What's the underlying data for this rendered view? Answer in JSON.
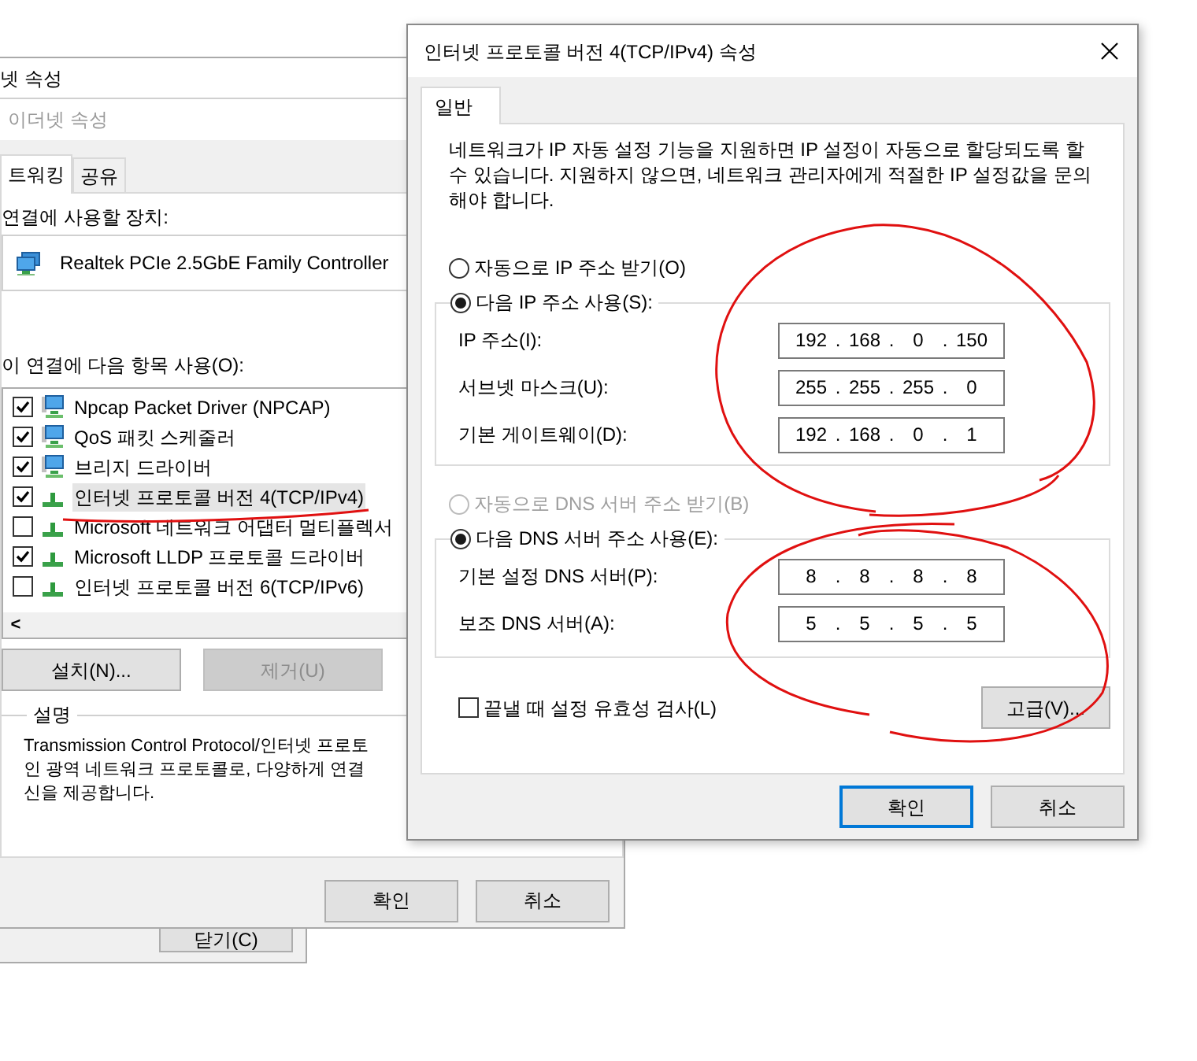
{
  "status_window": {
    "close_button": "닫기(C)"
  },
  "ethernet_window": {
    "title": "넷 속성",
    "subtitle": "이더넷 속성",
    "tabs": [
      {
        "label": "트워킹",
        "selected": true
      },
      {
        "label": "공유",
        "selected": false
      }
    ],
    "device_label": "연결에 사용할 장치:",
    "device": "Realtek PCIe 2.5GbE Family Controller",
    "items_label": "이 연결에 다음 항목 사용(O):",
    "items": [
      {
        "label": "Npcap Packet Driver (NPCAP)",
        "checked": true,
        "selected": false,
        "kind": "service"
      },
      {
        "label": "QoS 패킷 스케줄러",
        "checked": true,
        "selected": false,
        "kind": "service"
      },
      {
        "label": "브리지 드라이버",
        "checked": true,
        "selected": false,
        "kind": "service"
      },
      {
        "label": "인터넷 프로토콜 버전 4(TCP/IPv4)",
        "checked": true,
        "selected": true,
        "kind": "protocol"
      },
      {
        "label": "Microsoft 네트워크 어댑터 멀티플렉서",
        "checked": false,
        "selected": false,
        "kind": "protocol"
      },
      {
        "label": "Microsoft LLDP 프로토콜 드라이버",
        "checked": true,
        "selected": false,
        "kind": "protocol"
      },
      {
        "label": "인터넷 프로토콜 버전 6(TCP/IPv6)",
        "checked": false,
        "selected": false,
        "kind": "protocol"
      }
    ],
    "scroll_arrow": "<",
    "buttons": [
      {
        "label": "설치(N)...",
        "disabled": false
      },
      {
        "label": "제거(U)",
        "disabled": true
      }
    ],
    "description_title": "설명",
    "description_lines": [
      "Transmission Control Protocol/인터넷 프로토",
      "인 광역 네트워크 프로토콜로, 다양하게 연결",
      "신을 제공합니다."
    ],
    "footer_buttons": [
      "확인",
      "취소"
    ]
  },
  "ipv4_dialog": {
    "title": "인터넷 프로토콜 버전 4(TCP/IPv4) 속성",
    "tabs": [
      {
        "label": "일반",
        "selected": true
      }
    ],
    "intro": "네트워크가 IP 자동 설정 기능을 지원하면 IP 설정이 자동으로 할당되도록 할 수 있습니다. 지원하지 않으면, 네트워크 관리자에게 적절한 IP 설정값을 문의해야 합니다.",
    "ip_modes": [
      {
        "label": "자동으로 IP 주소 받기(O)",
        "selected": false,
        "disabled": false
      },
      {
        "label": "다음 IP 주소 사용(S):",
        "selected": true,
        "disabled": false
      }
    ],
    "ip_fields": [
      {
        "label": "IP 주소(I):",
        "segments": [
          "192",
          ".",
          "168",
          ".",
          "0",
          ".",
          "150"
        ]
      },
      {
        "label": "서브넷 마스크(U):",
        "segments": [
          "255",
          ".",
          "255",
          ".",
          "255",
          ".",
          "0"
        ]
      },
      {
        "label": "기본 게이트웨이(D):",
        "segments": [
          "192",
          ".",
          "168",
          ".",
          "0",
          ".",
          "1"
        ]
      }
    ],
    "dns_modes": [
      {
        "label": "자동으로 DNS 서버 주소 받기(B)",
        "selected": false,
        "disabled": true
      },
      {
        "label": "다음 DNS 서버 주소 사용(E):",
        "selected": true,
        "disabled": false
      }
    ],
    "dns_fields": [
      {
        "label": "기본 설정 DNS 서버(P):",
        "segments": [
          "8",
          ".",
          "8",
          ".",
          "8",
          ".",
          "8"
        ]
      },
      {
        "label": "보조 DNS 서버(A):",
        "segments": [
          "5",
          ".",
          "5",
          ".",
          "5",
          ".",
          "5"
        ]
      }
    ],
    "validate": {
      "label": "끝낼 때 설정 유효성 검사(L)",
      "checked": false
    },
    "advanced_button": "고급(V)...",
    "buttons": [
      {
        "label": "확인",
        "default": true
      },
      {
        "label": "취소",
        "default": false
      }
    ]
  }
}
